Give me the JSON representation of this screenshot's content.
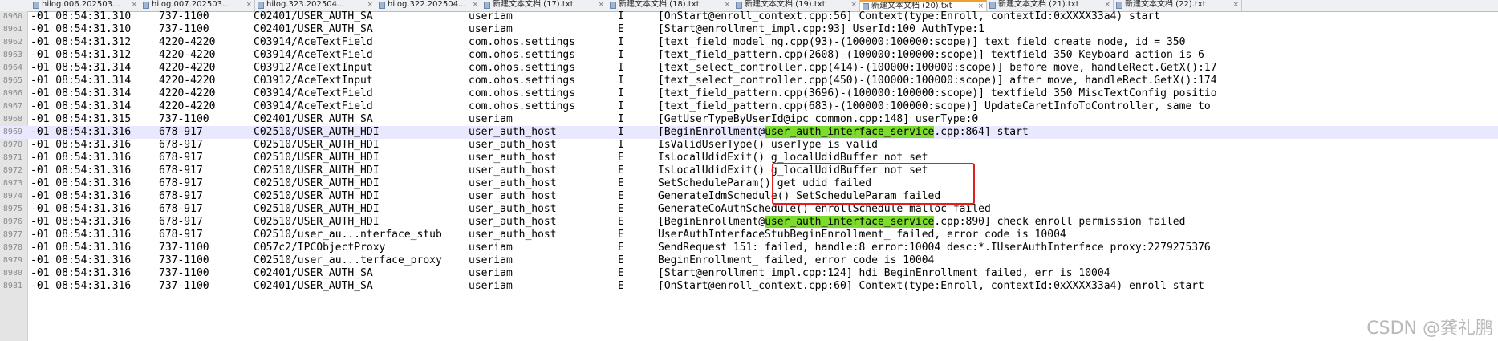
{
  "tabs": [
    {
      "label": "hilog.006.202503...",
      "active": false
    },
    {
      "label": "hilog.007.202503...",
      "active": false
    },
    {
      "label": "hilog.323.202504...",
      "active": false
    },
    {
      "label": "hilog.322.202504...",
      "active": false
    },
    {
      "label": "新建文本文档 (17).txt",
      "active": false
    },
    {
      "label": "新建文本文档 (18).txt",
      "active": false
    },
    {
      "label": "新建文本文档 (19).txt",
      "active": false
    },
    {
      "label": "新建文本文档 (20).txt",
      "active": true
    },
    {
      "label": "新建文本文档 (21).txt",
      "active": false
    },
    {
      "label": "新建文本文档 (22).txt",
      "active": false
    }
  ],
  "log_lines": [
    {
      "num": "8960",
      "time": "-01 08:54:31.310",
      "pid": "737-1100",
      "tag": "C02401/USER_AUTH_SA",
      "proc": "useriam",
      "level": "I",
      "pre": "[OnStart@enroll_context.cpp:56] Context(type:Enroll, contextId:0xXXXX33a4) start",
      "hl": "",
      "post": ""
    },
    {
      "num": "8961",
      "time": "-01 08:54:31.310",
      "pid": "737-1100",
      "tag": "C02401/USER_AUTH_SA",
      "proc": "useriam",
      "level": "E",
      "pre": "[Start@enrollment_impl.cpp:93] UserId:100 AuthType:1",
      "hl": "",
      "post": ""
    },
    {
      "num": "8962",
      "time": "-01 08:54:31.312",
      "pid": "4220-4220",
      "tag": "C03914/AceTextField",
      "proc": "com.ohos.settings",
      "level": "I",
      "pre": "[text_field_model_ng.cpp(93)-(100000:100000:scope)] text field create node, id = 350",
      "hl": "",
      "post": ""
    },
    {
      "num": "8963",
      "time": "-01 08:54:31.312",
      "pid": "4220-4220",
      "tag": "C03914/AceTextField",
      "proc": "com.ohos.settings",
      "level": "I",
      "pre": "[text_field_pattern.cpp(2608)-(100000:100000:scope)] textfield 350 Keyboard action is 6",
      "hl": "",
      "post": ""
    },
    {
      "num": "8964",
      "time": "-01 08:54:31.314",
      "pid": "4220-4220",
      "tag": "C03912/AceTextInput",
      "proc": "com.ohos.settings",
      "level": "I",
      "pre": "[text_select_controller.cpp(414)-(100000:100000:scope)] before move, handleRect.GetX():17",
      "hl": "",
      "post": ""
    },
    {
      "num": "8965",
      "time": "-01 08:54:31.314",
      "pid": "4220-4220",
      "tag": "C03912/AceTextInput",
      "proc": "com.ohos.settings",
      "level": "I",
      "pre": "[text_select_controller.cpp(450)-(100000:100000:scope)] after move, handleRect.GetX():174",
      "hl": "",
      "post": ""
    },
    {
      "num": "8966",
      "time": "-01 08:54:31.314",
      "pid": "4220-4220",
      "tag": "C03914/AceTextField",
      "proc": "com.ohos.settings",
      "level": "I",
      "pre": "[text_field_pattern.cpp(3696)-(100000:100000:scope)] textfield 350 MiscTextConfig positio",
      "hl": "",
      "post": ""
    },
    {
      "num": "8967",
      "time": "-01 08:54:31.314",
      "pid": "4220-4220",
      "tag": "C03914/AceTextField",
      "proc": "com.ohos.settings",
      "level": "I",
      "pre": "[text_field_pattern.cpp(683)-(100000:100000:scope)] UpdateCaretInfoToController, same to",
      "hl": "",
      "post": ""
    },
    {
      "num": "8968",
      "time": "-01 08:54:31.315",
      "pid": "737-1100",
      "tag": "C02401/USER_AUTH_SA",
      "proc": "useriam",
      "level": "I",
      "pre": "[GetUserTypeByUserId@ipc_common.cpp:148] userType:0",
      "hl": "",
      "post": ""
    },
    {
      "num": "8969",
      "time": "-01 08:54:31.316",
      "pid": "678-917",
      "tag": "C02510/USER_AUTH_HDI",
      "proc": "user_auth_host",
      "level": "I",
      "pre": "[BeginEnrollment@",
      "hl": "user_auth_interface_service",
      "post": ".cpp:864] start"
    },
    {
      "num": "8970",
      "time": "-01 08:54:31.316",
      "pid": "678-917",
      "tag": "C02510/USER_AUTH_HDI",
      "proc": "user_auth_host",
      "level": "I",
      "pre": "IsValidUserType() userType is valid",
      "hl": "",
      "post": ""
    },
    {
      "num": "8971",
      "time": "-01 08:54:31.316",
      "pid": "678-917",
      "tag": "C02510/USER_AUTH_HDI",
      "proc": "user_auth_host",
      "level": "E",
      "pre": "IsLocalUdidExit() g_localUdidBuffer not set",
      "hl": "",
      "post": ""
    },
    {
      "num": "8972",
      "time": "-01 08:54:31.316",
      "pid": "678-917",
      "tag": "C02510/USER_AUTH_HDI",
      "proc": "user_auth_host",
      "level": "E",
      "pre": "IsLocalUdidExit() g_localUdidBuffer not set",
      "hl": "",
      "post": ""
    },
    {
      "num": "8973",
      "time": "-01 08:54:31.316",
      "pid": "678-917",
      "tag": "C02510/USER_AUTH_HDI",
      "proc": "user_auth_host",
      "level": "E",
      "pre": "SetScheduleParam() get udid failed",
      "hl": "",
      "post": ""
    },
    {
      "num": "8974",
      "time": "-01 08:54:31.316",
      "pid": "678-917",
      "tag": "C02510/USER_AUTH_HDI",
      "proc": "user_auth_host",
      "level": "E",
      "pre": "GenerateIdmSchedule() SetScheduleParam failed",
      "hl": "",
      "post": ""
    },
    {
      "num": "8975",
      "time": "-01 08:54:31.316",
      "pid": "678-917",
      "tag": "C02510/USER_AUTH_HDI",
      "proc": "user_auth_host",
      "level": "E",
      "pre": "GenerateCoAuthSchedule() enrollSchedule malloc failed",
      "hl": "",
      "post": ""
    },
    {
      "num": "8976",
      "time": "-01 08:54:31.316",
      "pid": "678-917",
      "tag": "C02510/USER_AUTH_HDI",
      "proc": "user_auth_host",
      "level": "E",
      "pre": "[BeginEnrollment@",
      "hl": "user_auth_interface_service",
      "post": ".cpp:890] check enroll permission failed"
    },
    {
      "num": "8977",
      "time": "-01 08:54:31.316",
      "pid": "678-917",
      "tag": "C02510/user_au...nterface_stub",
      "proc": "user_auth_host",
      "level": "E",
      "pre": "UserAuthInterfaceStubBeginEnrollment_ failed, error code is 10004",
      "hl": "",
      "post": ""
    },
    {
      "num": "8978",
      "time": "-01 08:54:31.316",
      "pid": "737-1100",
      "tag": "C057c2/IPCObjectProxy",
      "proc": "useriam",
      "level": "E",
      "pre": "SendRequest 151: failed, handle:8 error:10004 desc:*.IUserAuthInterface proxy:2279275376",
      "hl": "",
      "post": ""
    },
    {
      "num": "8979",
      "time": "-01 08:54:31.316",
      "pid": "737-1100",
      "tag": "C02510/user_au...terface_proxy",
      "proc": "useriam",
      "level": "E",
      "pre": "BeginEnrollment_ failed, error code is 10004",
      "hl": "",
      "post": ""
    },
    {
      "num": "8980",
      "time": "-01 08:54:31.316",
      "pid": "737-1100",
      "tag": "C02401/USER_AUTH_SA",
      "proc": "useriam",
      "level": "E",
      "pre": "[Start@enrollment_impl.cpp:124] hdi BeginEnrollment failed, err is 10004",
      "hl": "",
      "post": ""
    },
    {
      "num": "8981",
      "time": "-01 08:54:31.316",
      "pid": "737-1100",
      "tag": "C02401/USER_AUTH_SA",
      "proc": "useriam",
      "level": "E",
      "pre": "[OnStart@enroll_context.cpp:60] Context(type:Enroll, contextId:0xXXXX33a4) enroll start",
      "hl": "",
      "post": ""
    }
  ],
  "selected_line_index": 9,
  "watermark": "CSDN @龚礼鹏",
  "colors": {
    "highlight": "#7ddb2c",
    "annotation_box": "#e02020",
    "active_tab_accent": "#f0a030"
  }
}
